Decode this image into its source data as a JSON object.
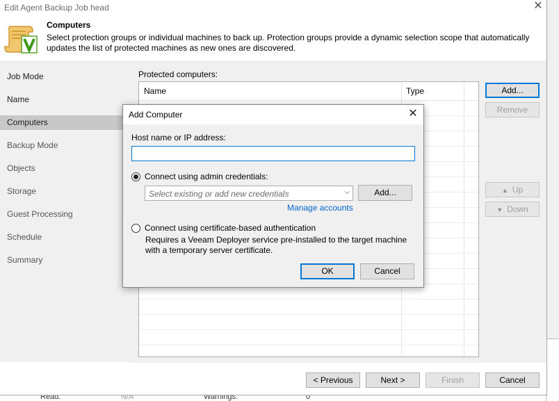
{
  "window": {
    "title": "Edit Agent Backup Job head"
  },
  "header": {
    "title": "Computers",
    "description": "Select protection groups or individual machines to back up. Protection groups provide a dynamic selection scope that automatically updates the list of protected machines as new ones are discovered."
  },
  "nav": {
    "items": [
      {
        "label": "Job Mode"
      },
      {
        "label": "Name"
      },
      {
        "label": "Computers"
      },
      {
        "label": "Backup Mode"
      },
      {
        "label": "Objects"
      },
      {
        "label": "Storage"
      },
      {
        "label": "Guest Processing"
      },
      {
        "label": "Schedule"
      },
      {
        "label": "Summary"
      }
    ]
  },
  "content": {
    "protected_label": "Protected computers:",
    "columns": [
      "Name",
      "Type"
    ],
    "buttons": {
      "add": "Add...",
      "remove": "Remove",
      "up": "Up",
      "down": "Down"
    }
  },
  "footer": {
    "previous": "< Previous",
    "next": "Next >",
    "finish": "Finish",
    "cancel": "Cancel"
  },
  "dialog": {
    "title": "Add Computer",
    "host_label": "Host name or IP address:",
    "host_value": "",
    "option_admin": "Connect using admin credentials:",
    "cred_placeholder": "Select existing or add new credentials",
    "cred_add": "Add...",
    "manage_accounts": "Manage accounts",
    "option_cert": "Connect using certificate-based authentication",
    "cert_note_1": "Requires a Veeam Deployer service pre-installed to the target machine",
    "cert_note_2": "with a temporary server certificate.",
    "ok": "OK",
    "cancel": "Cancel"
  },
  "background": {
    "read_label": "Read:",
    "read_value": "N/A",
    "warnings_label": "Warnings:",
    "warnings_value": "0"
  },
  "colors": {
    "accent": "#0078d7",
    "link": "#0066cc",
    "selected_nav": "#c8c8c8"
  }
}
